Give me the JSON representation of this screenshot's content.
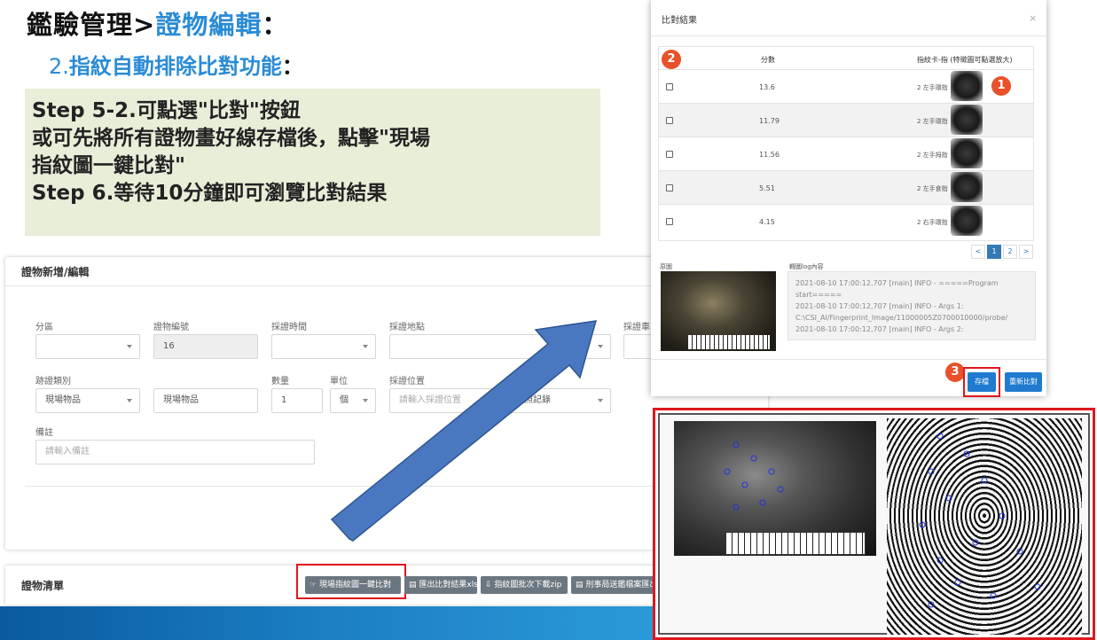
{
  "header": {
    "title_prefix": "鑑驗管理>",
    "title_highlight": "證物編輯",
    "title_colon": "：",
    "subtitle_num": "2.",
    "subtitle_text": "指紋自動排除比對功能",
    "subtitle_colon": "："
  },
  "steps": [
    "Step 5-2.可點選\"比對\"按鈕",
    "或可先將所有證物畫好線存檔後，點擊\"現場",
    "指紋圖一鍵比對\"",
    "Step  6.等待10分鐘即可瀏覽比對結果"
  ],
  "form": {
    "title": "證物新增/編輯",
    "labels": {
      "zone": "分區",
      "evidence_no": "證物編號",
      "collect_time": "採證時間",
      "collect_place": "採證地點",
      "collect_vehicle": "採證車",
      "trace_type": "跡證類別",
      "quantity": "數量",
      "unit": "單位",
      "collect_position": "採證位置",
      "remark": "備註"
    },
    "values": {
      "evidence_no": "16",
      "trace_type": "現場物品",
      "trace_subtype": "現場物品",
      "quantity": "1",
      "unit": "個",
      "photo_record": "拍照記錄"
    },
    "placeholders": {
      "collect_position": "請輸入採證位置",
      "remark": "請輸入備註"
    }
  },
  "list": {
    "title": "證物清單",
    "buttons": {
      "one_click": "現場指紋圖一鍵比對",
      "export_xls": "匯出比對結果xls",
      "download_zip": "指紋圖批次下載zip",
      "send_case": "刑事局送鑑檔案匯出"
    }
  },
  "modal": {
    "title": "比對結果",
    "close": "×",
    "headers": {
      "score": "分數",
      "finger": "指紋卡-指 (特徵圖可點選放大)"
    },
    "rows": [
      {
        "score": "13.6",
        "finger": "2 左手環指"
      },
      {
        "score": "11.79",
        "finger": "2 左手環指"
      },
      {
        "score": "11.56",
        "finger": "2 左手拇指"
      },
      {
        "score": "5.51",
        "finger": "2 左手食指"
      },
      {
        "score": "4.15",
        "finger": "2 右手環指"
      }
    ],
    "pagination": [
      "<",
      "1",
      "2",
      ">"
    ],
    "source_label": "原圖",
    "log_label": "轉圖log內容",
    "log_lines": [
      "2021-08-10 17:00:12,707 [main] INFO  - =====Program",
      "start=====",
      "2021-08-10 17:00:12,707 [main] INFO  - Args 1:",
      "C:\\CSI_AI/Fingerprint_Image/11000005Z0700010000/probe/",
      "2021-08-10 17:00:12,707 [main] INFO  - Args 2:"
    ],
    "save_button": "存檔",
    "recompare_button": "重新比對"
  },
  "badges": [
    "1",
    "2",
    "3"
  ],
  "colors": {
    "accent_blue": "#2a8bd6",
    "highlight_red": "#e0171f",
    "badge_orange": "#e8512a",
    "arrow_blue": "#4a78c0",
    "step_box": "#e8eed8"
  }
}
